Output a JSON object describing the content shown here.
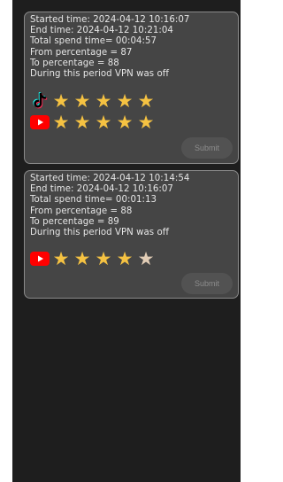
{
  "sessions": [
    {
      "start": "Started time:  2024-04-12 10:16:07",
      "end": "End time:  2024-04-12 10:21:04",
      "total": "Total spend time= 00:04:57",
      "from": "From percentage = 87",
      "to": "To percentage = 88",
      "vpn": "During this period VPN was off",
      "ratings": [
        {
          "app_icon": "tiktok-icon",
          "stars": [
            1,
            1,
            1,
            1,
            1
          ]
        },
        {
          "app_icon": "youtube-icon",
          "stars": [
            1,
            1,
            1,
            1,
            1
          ]
        }
      ],
      "submit_label": "Submit"
    },
    {
      "start": "Started time:  2024-04-12 10:14:54",
      "end": "End time:  2024-04-12 10:16:07",
      "total": "Total spend time= 00:01:13",
      "from": "From percentage = 88",
      "to": "To percentage = 89",
      "vpn": "During this period VPN was off",
      "ratings": [
        {
          "app_icon": "youtube-icon",
          "stars": [
            1,
            1,
            1,
            1,
            0
          ]
        }
      ],
      "submit_label": "Submit"
    }
  ],
  "colors": {
    "star_filled": "#f5c242",
    "star_empty": "#e2cdb6",
    "card_bg": "#454545",
    "screen_bg": "#1e1e1e"
  }
}
